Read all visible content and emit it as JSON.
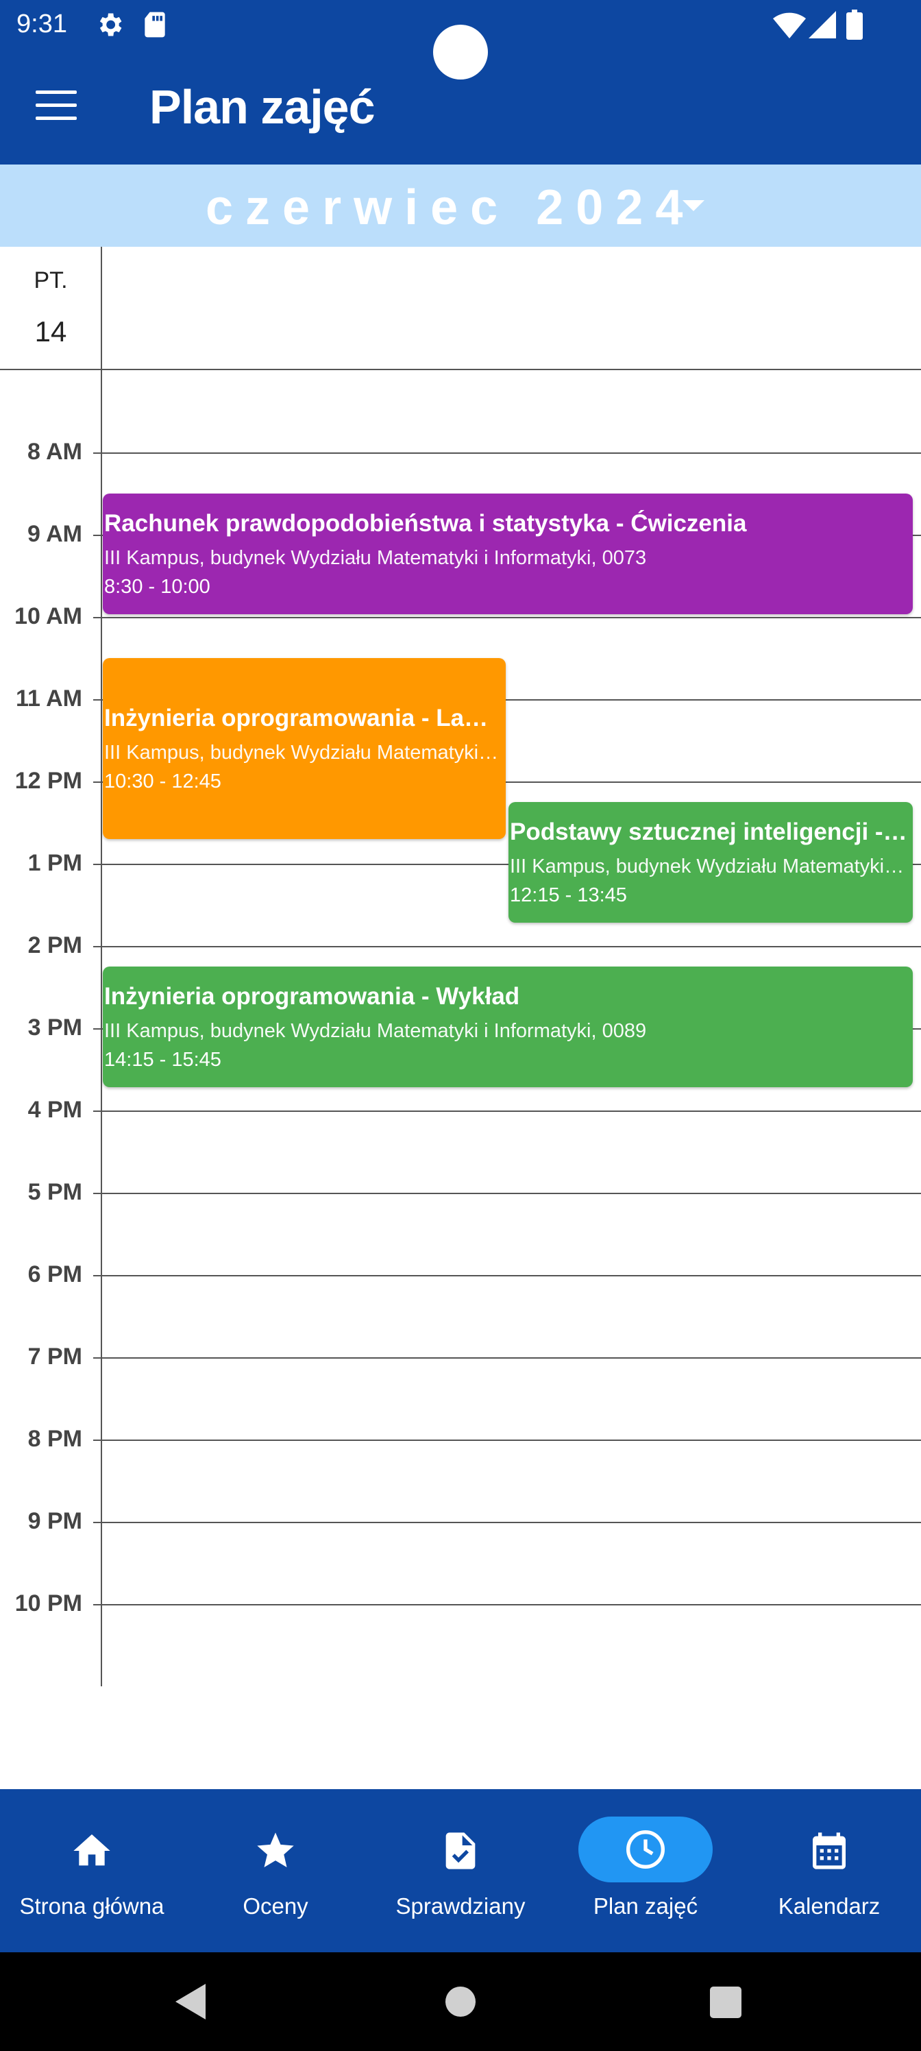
{
  "status_bar": {
    "time": "9:31",
    "icons": [
      "gear-icon",
      "sd-card-icon",
      "wifi-icon",
      "signal-icon",
      "battery-icon"
    ]
  },
  "app_bar": {
    "title": "Plan zajęć",
    "menu_icon": "hamburger-icon"
  },
  "month_header": {
    "label": "czerwiec 2024"
  },
  "day_header": {
    "day_name": "PT.",
    "day_number": "14"
  },
  "hours": [
    "8 AM",
    "9 AM",
    "10 AM",
    "11 AM",
    "12 PM",
    "1 PM",
    "2 PM",
    "3 PM",
    "4 PM",
    "5 PM",
    "6 PM",
    "7 PM",
    "8 PM",
    "9 PM",
    "10 PM"
  ],
  "events": [
    {
      "title": "Rachunek prawdopodobieństwa i statystyka - Ćwiczenia",
      "place": "III Kampus, budynek Wydziału Matematyki i Informatyki, 0073",
      "time": "8:30 - 10:00",
      "color": "#9c27b0"
    },
    {
      "title": "Inżynieria oprogramowania - Laboratoria",
      "place": "III Kampus, budynek Wydziału Matematyki i Informatyki",
      "time": "10:30 - 12:45",
      "color": "#ff9800"
    },
    {
      "title": "Podstawy sztucznej inteligencji - Laboratoria",
      "place": "III Kampus, budynek Wydziału Matematyki i Informatyki",
      "time": "12:15 - 13:45",
      "color": "#4caf50"
    },
    {
      "title": "Inżynieria oprogramowania - Wykład",
      "place": "III Kampus, budynek Wydziału Matematyki i Informatyki, 0089",
      "time": "14:15 - 15:45",
      "color": "#4caf50"
    }
  ],
  "bottom_nav": {
    "items": [
      {
        "label": "Strona główna",
        "icon": "home-icon",
        "active": false
      },
      {
        "label": "Oceny",
        "icon": "star-icon",
        "active": false
      },
      {
        "label": "Sprawdziany",
        "icon": "assignment-check-icon",
        "active": false
      },
      {
        "label": "Plan zajęć",
        "icon": "clock-icon",
        "active": true
      },
      {
        "label": "Kalendarz",
        "icon": "calendar-icon",
        "active": false
      }
    ]
  },
  "colors": {
    "primary": "#0d47a1",
    "month_bar": "#bbdefb",
    "active_pill": "#2196f3"
  }
}
